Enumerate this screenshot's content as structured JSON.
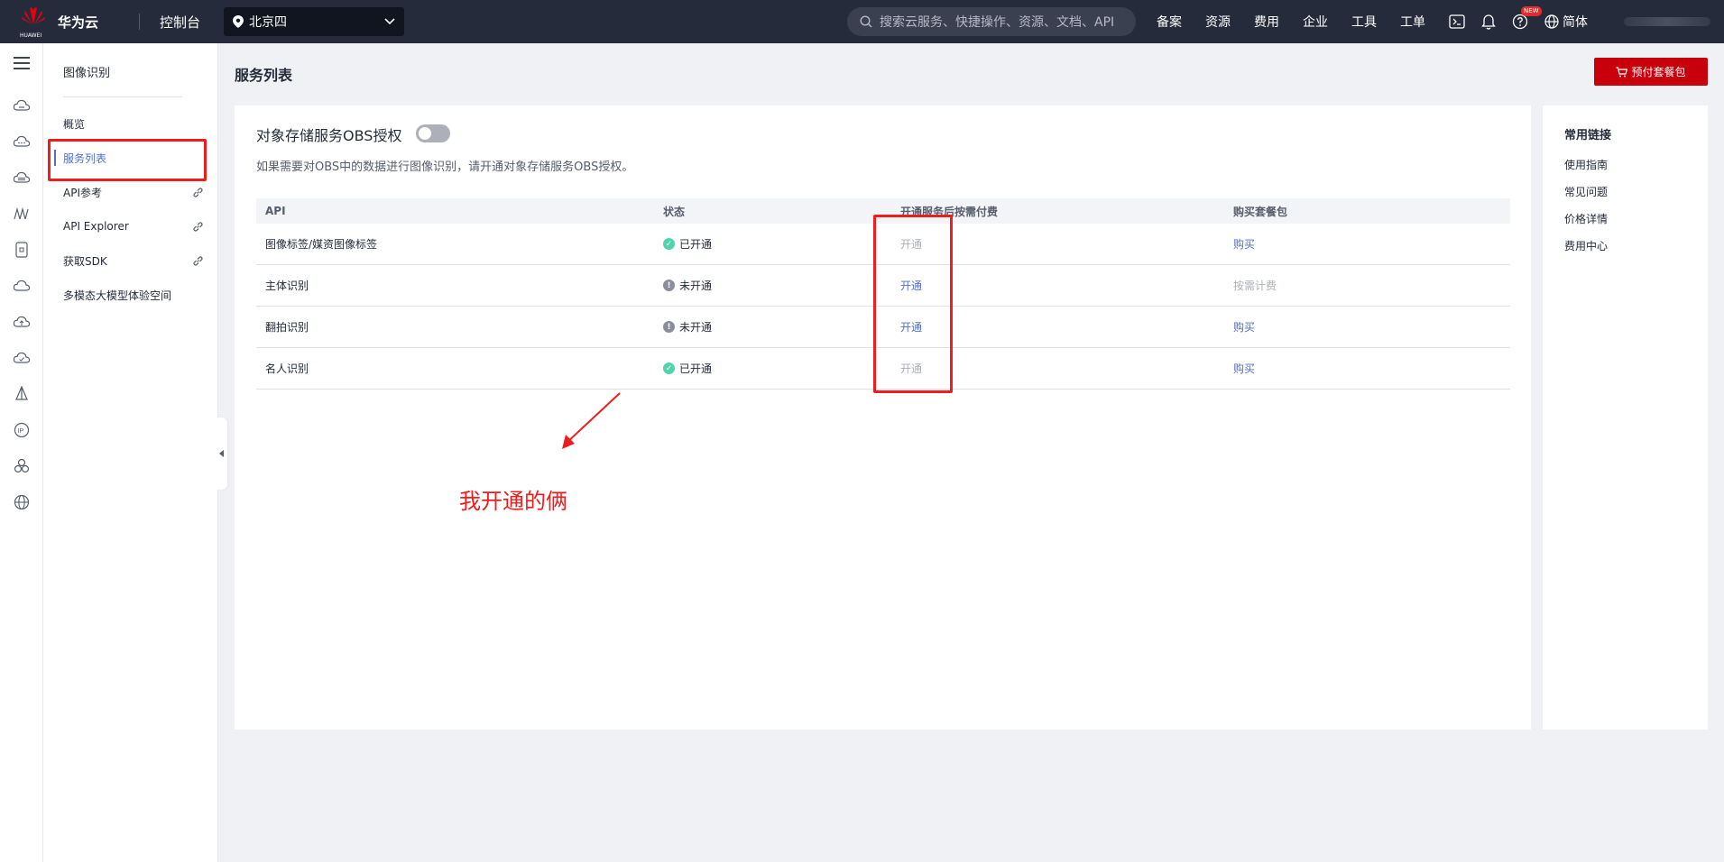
{
  "topbar": {
    "brand": "华为云",
    "logo_small": "HUAWEI",
    "console": "控制台",
    "region": "北京四",
    "search_placeholder": "搜索云服务、快捷操作、资源、文档、API",
    "nav": [
      "备案",
      "资源",
      "费用",
      "企业",
      "工具",
      "工单"
    ],
    "new_badge": "NEW",
    "language": "简体"
  },
  "sidebar": {
    "title": "图像识别",
    "items": [
      {
        "label": "概览"
      },
      {
        "label": "服务列表"
      },
      {
        "label": "API参考"
      },
      {
        "label": "API Explorer"
      },
      {
        "label": "获取SDK"
      },
      {
        "label": "多模态大模型体验空间"
      }
    ]
  },
  "main": {
    "page_title": "服务列表",
    "buy_button": "预付套餐包",
    "obs_title": "对象存储服务OBS授权",
    "obs_toggle_on": false,
    "obs_desc": "如果需要对OBS中的数据进行图像识别，请开通对象存储服务OBS授权。",
    "table": {
      "headers": [
        "API",
        "状态",
        "开通服务后按需付费",
        "购买套餐包"
      ],
      "rows": [
        {
          "api": "图像标签/媒资图像标签",
          "status": "已开通",
          "status_type": "ok",
          "action": "开通",
          "action_enabled": false,
          "buy": "购买",
          "buy_enabled": true
        },
        {
          "api": "主体识别",
          "status": "未开通",
          "status_type": "no",
          "action": "开通",
          "action_enabled": true,
          "buy": "按需计费",
          "buy_enabled": false
        },
        {
          "api": "翻拍识别",
          "status": "未开通",
          "status_type": "no",
          "action": "开通",
          "action_enabled": true,
          "buy": "购买",
          "buy_enabled": true
        },
        {
          "api": "名人识别",
          "status": "已开通",
          "status_type": "ok",
          "action": "开通",
          "action_enabled": false,
          "buy": "购买",
          "buy_enabled": true
        }
      ]
    },
    "annotation": "我开通的俩"
  },
  "right_panel": {
    "title": "常用链接",
    "links": [
      "使用指南",
      "常见问题",
      "价格详情",
      "费用中心"
    ]
  },
  "colors": {
    "topbar_bg": "#252b3a",
    "accent_link": "#526ecc",
    "buy_button": "#c7000b",
    "annotation_red": "#f01d1d",
    "status_ok": "#50d4ab",
    "status_no": "#8a8e99"
  }
}
